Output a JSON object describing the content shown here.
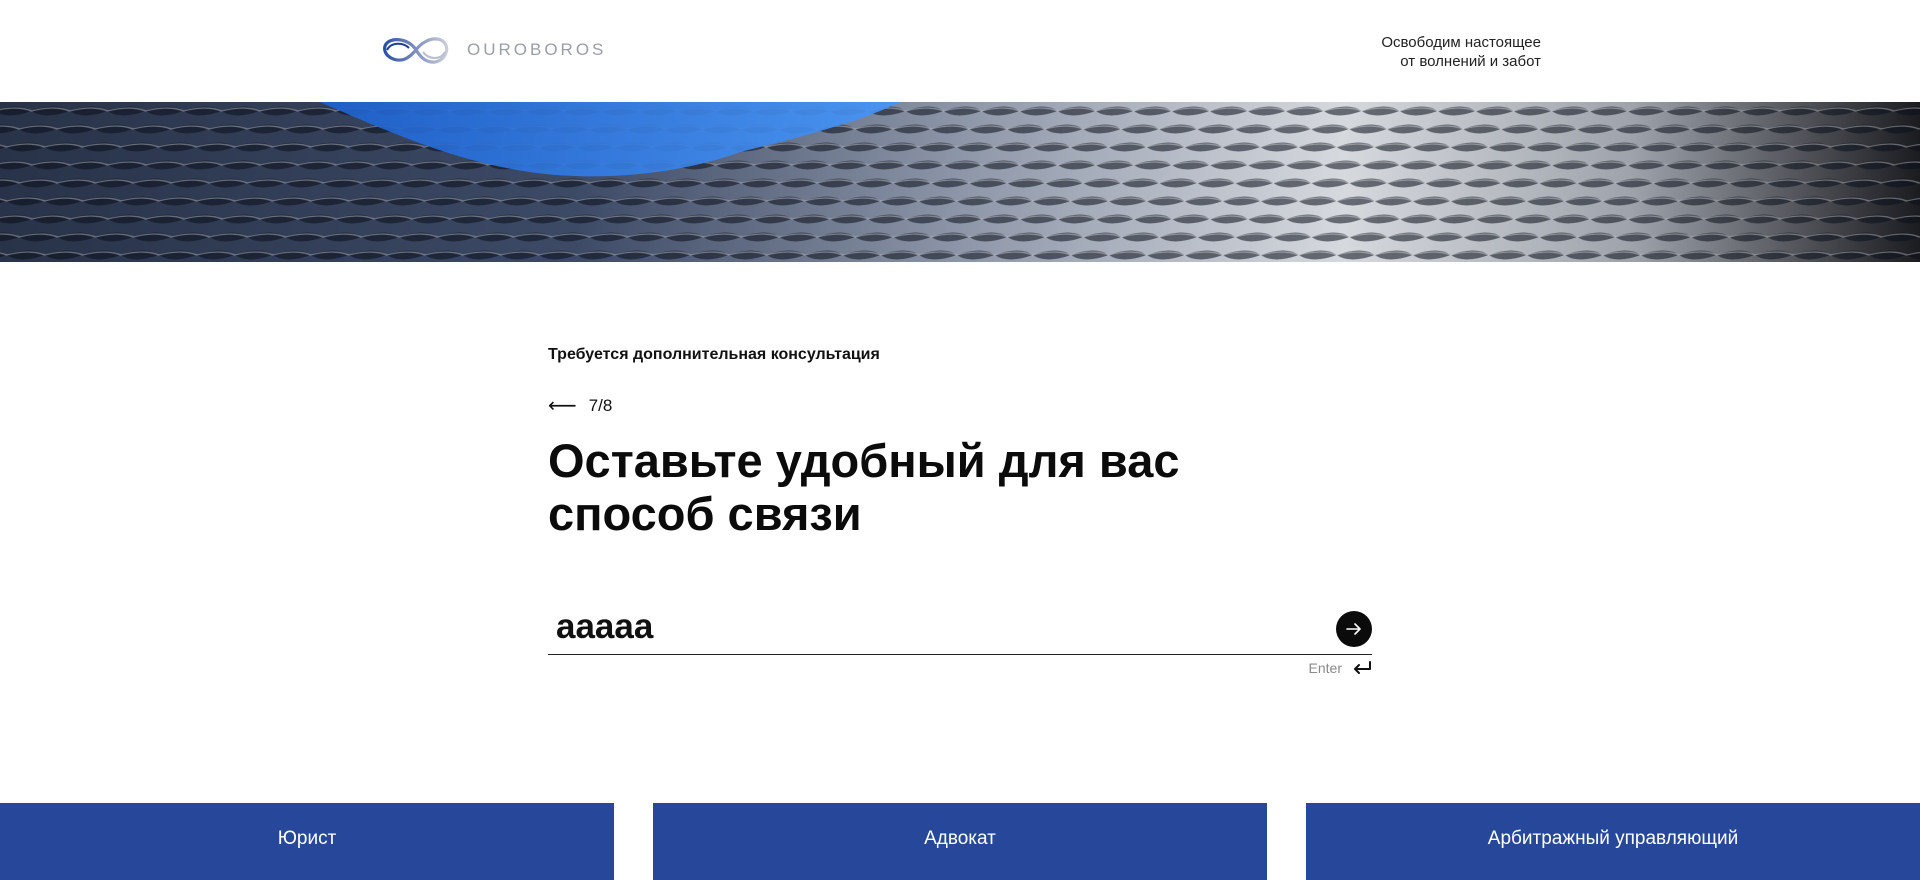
{
  "header": {
    "logo_text": "OUROBOROS",
    "tagline_line1": "Освободим настоящее",
    "tagline_line2": "от волнений и забот"
  },
  "form": {
    "section_label": "Требуется дополнительная консультация",
    "step": "7/8",
    "heading_line1": "Оставьте удобный для вас",
    "heading_line2": "способ связи",
    "input_value": "aaaaa",
    "enter_hint": "Enter"
  },
  "roles": [
    {
      "label": "Юрист"
    },
    {
      "label": "Адвокат"
    },
    {
      "label": "Арбитражный управляющий"
    }
  ],
  "colors": {
    "accent": "#27489a",
    "logo_blue": "#2b4fa8",
    "sky": "#2f7be0"
  },
  "icons": {
    "back": "left-arrow-icon",
    "submit": "right-arrow-icon",
    "enter": "return-key-icon",
    "logo": "infinity-logo-icon"
  }
}
